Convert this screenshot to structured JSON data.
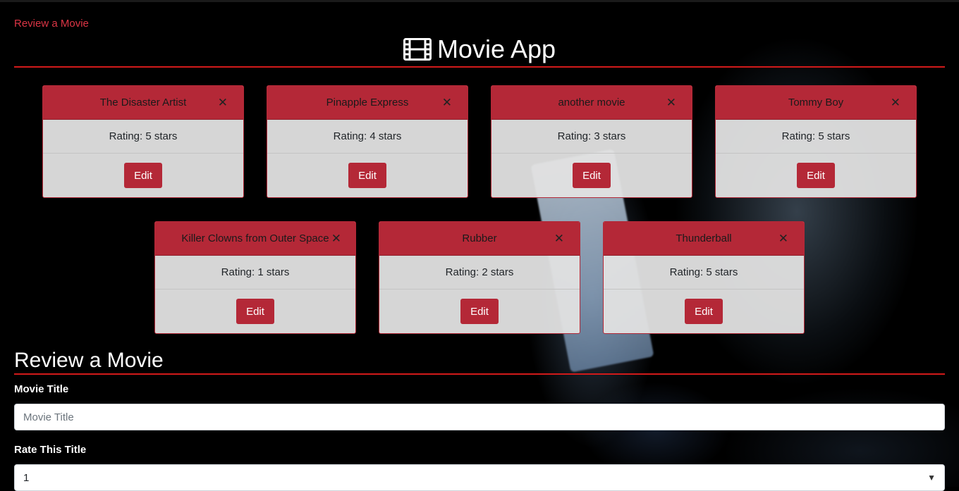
{
  "nav": {
    "review_link": "Review a Movie"
  },
  "header": {
    "title": "Movie App",
    "icon": "film-icon"
  },
  "movies": [
    {
      "title": "The Disaster Artist",
      "rating": "Rating: 5 stars",
      "edit_label": "Edit"
    },
    {
      "title": "Pinapple Express",
      "rating": "Rating: 4 stars",
      "edit_label": "Edit"
    },
    {
      "title": "another movie",
      "rating": "Rating: 3 stars",
      "edit_label": "Edit"
    },
    {
      "title": "Tommy Boy",
      "rating": "Rating: 5 stars",
      "edit_label": "Edit"
    },
    {
      "title": "Killer Clowns from Outer Space",
      "rating": "Rating: 1 stars",
      "edit_label": "Edit"
    },
    {
      "title": "Rubber",
      "rating": "Rating: 2 stars",
      "edit_label": "Edit"
    },
    {
      "title": "Thunderball",
      "rating": "Rating: 5 stars",
      "edit_label": "Edit"
    }
  ],
  "form": {
    "heading": "Review a Movie",
    "title_label": "Movie Title",
    "title_placeholder": "Movie Title",
    "rate_label": "Rate This Title",
    "rate_selected": "1"
  },
  "colors": {
    "accent": "#b42837",
    "link": "#dc3545",
    "rule": "#d11a1a"
  }
}
